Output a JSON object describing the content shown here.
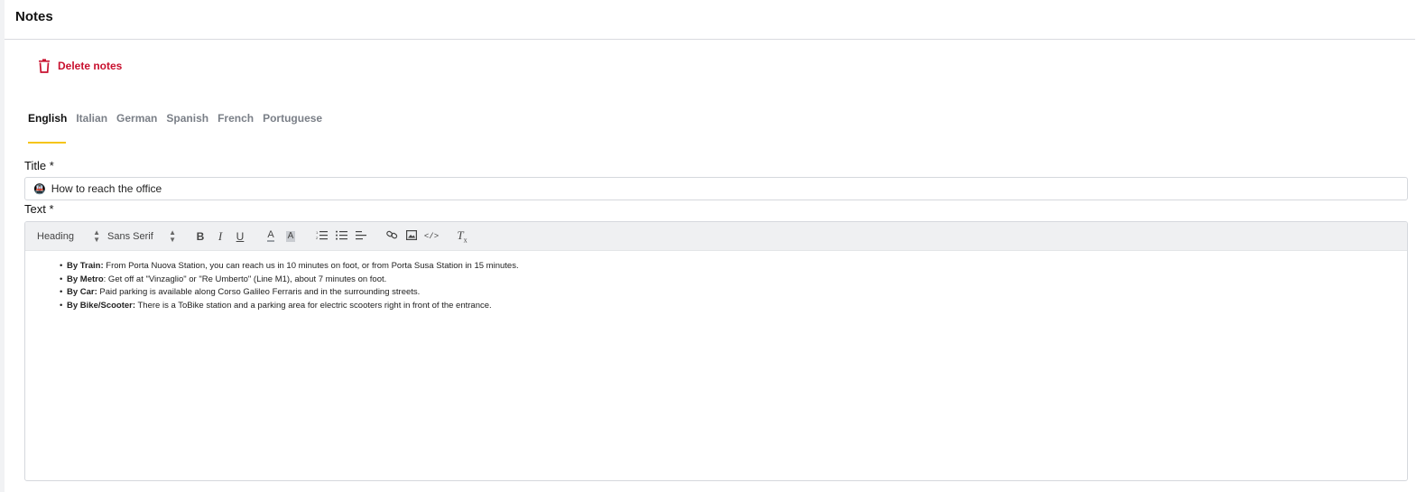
{
  "page": {
    "title": "Notes"
  },
  "actions": {
    "delete_label": "Delete notes",
    "delete_color": "#c8102e"
  },
  "tabs": [
    {
      "label": "English",
      "active": true
    },
    {
      "label": "Italian",
      "active": false
    },
    {
      "label": "German",
      "active": false
    },
    {
      "label": "Spanish",
      "active": false
    },
    {
      "label": "French",
      "active": false
    },
    {
      "label": "Portuguese",
      "active": false
    }
  ],
  "accent_color": "#f5c518",
  "form": {
    "title_label": "Title *",
    "title_icon": "🚇",
    "title_value": "How to reach the office",
    "text_label": "Text *"
  },
  "toolbar": {
    "heading_select": "Heading",
    "font_select": "Sans Serif",
    "buttons": [
      "bold-icon",
      "italic-icon",
      "underline-icon",
      "text-color-icon",
      "background-color-icon",
      "ordered-list-icon",
      "bullet-list-icon",
      "align-icon",
      "link-icon",
      "image-icon",
      "code-icon",
      "clear-format-icon"
    ]
  },
  "editor_content": [
    {
      "label": "By Train:",
      "text": " From Porta Nuova Station, you can reach us in 10 minutes on foot, or from Porta Susa Station in 15 minutes."
    },
    {
      "label": "By Metro",
      "text": ": Get off at \"Vinzaglio\" or \"Re Umberto\" (Line M1), about 7 minutes on foot."
    },
    {
      "label": "By Car:",
      "text": " Paid parking is available along Corso Galileo Ferraris and in the surrounding streets."
    },
    {
      "label": "By Bike/Scooter:",
      "text": " There is a ToBike station and a parking area for electric scooters right in front of the entrance."
    }
  ]
}
